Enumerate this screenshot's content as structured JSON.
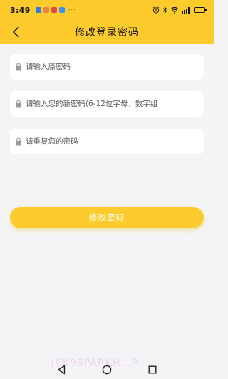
{
  "status_bar": {
    "time": "3:49",
    "more_notifications": "···",
    "notification_icons": [
      {
        "name": "app-notification-icon",
        "color": "#2f7be6"
      },
      {
        "name": "video-notification-icon",
        "color": "#e8873a"
      },
      {
        "name": "message-notification-icon",
        "color": "#e14a4a"
      },
      {
        "name": "search-notification-icon",
        "color": "#3b8ef0"
      }
    ],
    "system_icons": [
      "alarm-icon",
      "bluetooth-icon",
      "wifi-icon",
      "signal-icon",
      "battery-icon"
    ],
    "battery_level": 0.7
  },
  "header": {
    "background": "#fdcb2c",
    "title": "修改登录密码",
    "back_icon": "chevron-left-icon"
  },
  "form": {
    "old_password": {
      "placeholder": "请输入原密码",
      "value": "",
      "icon": "lock-icon"
    },
    "new_password": {
      "placeholder": "请输入您的新密码(6-12位字母，数字组",
      "value": "",
      "icon": "lock-icon"
    },
    "confirm_password": {
      "placeholder": "请重复您的密码",
      "value": "",
      "icon": "lock-icon"
    },
    "submit_label": "修改密码"
  },
  "watermark": "JCK9SPARKH…P",
  "system_nav": [
    "back-triangle-icon",
    "home-circle-icon",
    "recents-square-icon"
  ],
  "colors": {
    "accent": "#fdcb2c",
    "background": "#f4f4f6",
    "field": "#ffffff"
  }
}
